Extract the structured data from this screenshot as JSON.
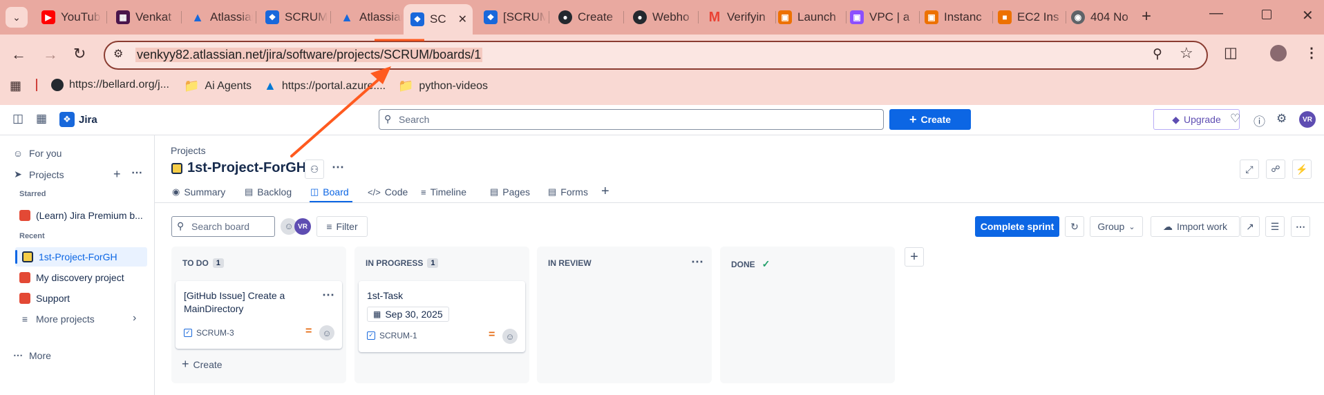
{
  "browser": {
    "tabs": [
      {
        "label": "YouTube",
        "icon": "youtube-icon",
        "color": "#ff0000"
      },
      {
        "label": "Venkat",
        "icon": "slack-icon",
        "color": "#4a154b"
      },
      {
        "label": "Atlassian",
        "icon": "atlassian-icon",
        "color": "#1868db"
      },
      {
        "label": "SCRUM",
        "icon": "jira-icon",
        "color": "#1868db"
      },
      {
        "label": "Atlassian",
        "icon": "atlassian-icon",
        "color": "#1868db"
      },
      {
        "label": "SC",
        "icon": "jira-icon",
        "color": "#1868db"
      },
      {
        "label": "[SCRUM",
        "icon": "jira-icon",
        "color": "#1868db"
      },
      {
        "label": "Create",
        "icon": "github-icon",
        "color": "#24292f"
      },
      {
        "label": "Webho",
        "icon": "github-icon",
        "color": "#24292f"
      },
      {
        "label": "Verifyin",
        "icon": "gmail-icon",
        "color": "#ea4335"
      },
      {
        "label": "Launch",
        "icon": "aws-ec2-icon",
        "color": "#ed7100"
      },
      {
        "label": "VPC | a",
        "icon": "aws-vpc-icon",
        "color": "#8c4fff"
      },
      {
        "label": "Instanc",
        "icon": "aws-ec2-icon",
        "color": "#ed7100"
      },
      {
        "label": "EC2 Ins",
        "icon": "aws-box-icon",
        "color": "#ed7100"
      },
      {
        "label": "404 No",
        "icon": "globe-icon",
        "color": "#5f6368"
      }
    ],
    "url": "venkyy82.atlassian.net/jira/software/projects/SCRUM/boards/1",
    "bookmarks": [
      {
        "label": "https://bellard.org/j...",
        "icon": "github-icon"
      },
      {
        "label": "Ai Agents",
        "icon": "folder-icon"
      },
      {
        "label": "https://portal.azure....",
        "icon": "azure-icon"
      },
      {
        "label": "python-videos",
        "icon": "folder-icon"
      }
    ],
    "colors": {
      "tabstrip": "#e9a9a0",
      "toolbar": "#f9d9d3",
      "annotation_arrow": "#ff5a1f"
    }
  },
  "jira": {
    "app_name": "Jira",
    "search_placeholder": "Search",
    "create_label": "Create",
    "upgrade_label": "Upgrade",
    "user_initials": "VR"
  },
  "sidebar": {
    "for_you": "For you",
    "projects": "Projects",
    "starred_header": "Starred",
    "starred_item": "(Learn) Jira Premium b...",
    "recent_header": "Recent",
    "recent_items": [
      "1st-Project-ForGH",
      "My discovery project",
      "Support"
    ],
    "more_projects": "More projects",
    "more": "More"
  },
  "main": {
    "breadcrumb": "Projects",
    "project_title": "1st-Project-ForGH",
    "tabs": [
      "Summary",
      "Backlog",
      "Board",
      "Code",
      "Timeline",
      "Pages",
      "Forms"
    ],
    "active_tab": "Board",
    "board_search_placeholder": "Search board",
    "filter_label": "Filter",
    "complete_sprint_label": "Complete sprint",
    "group_label": "Group",
    "import_label": "Import work"
  },
  "board": {
    "columns": [
      {
        "title": "TO DO",
        "count": "1"
      },
      {
        "title": "IN PROGRESS",
        "count": "1"
      },
      {
        "title": "IN REVIEW",
        "count": ""
      },
      {
        "title": "DONE",
        "count": ""
      }
    ],
    "cards": [
      {
        "title": "[GitHub Issue] Create a MainDirectory",
        "key": "SCRUM-3",
        "date": ""
      },
      {
        "title": "1st-Task",
        "key": "SCRUM-1",
        "date": "Sep 30, 2025"
      }
    ],
    "create_label": "Create"
  }
}
